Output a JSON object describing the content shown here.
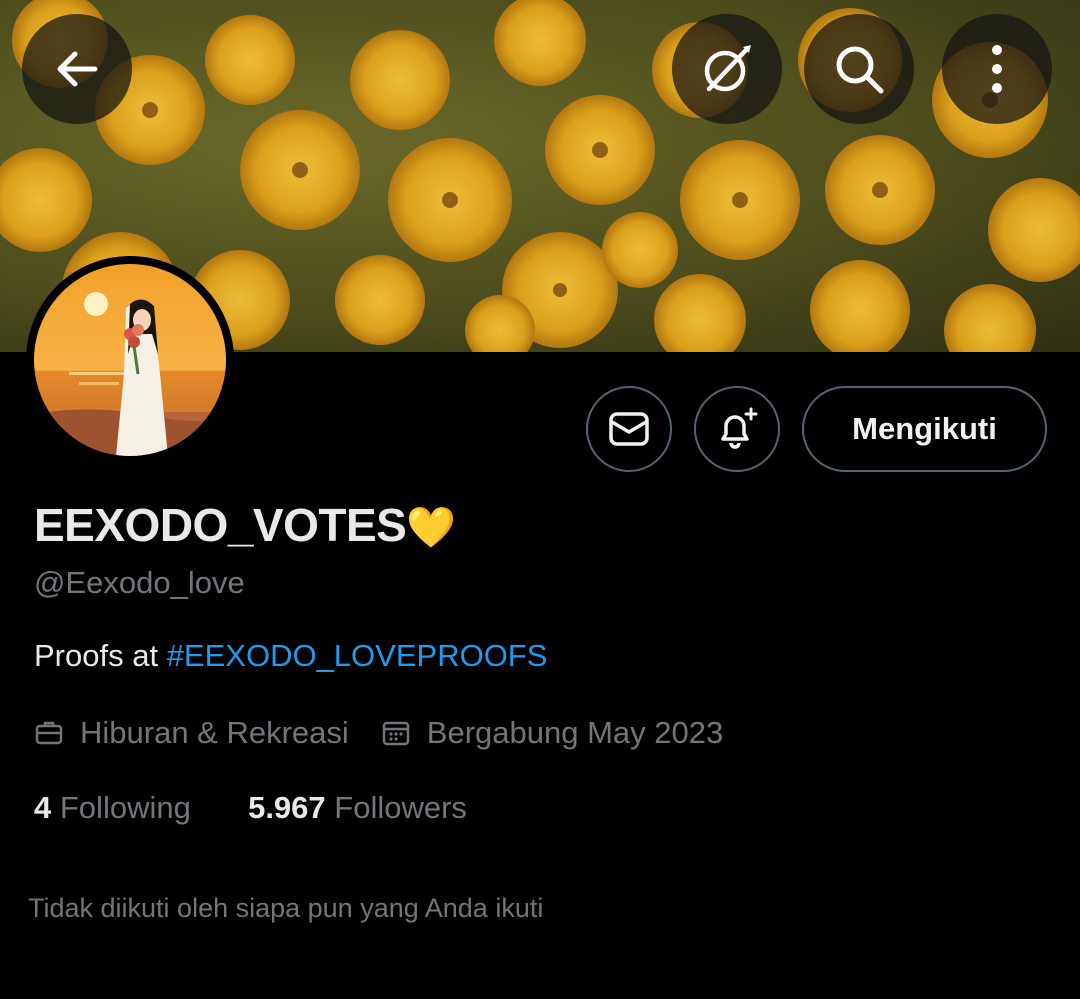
{
  "banner": {
    "description": "yellow-flowers-banner"
  },
  "header_buttons": {
    "back_icon": "arrow-left-icon",
    "grok_icon": "grok-icon",
    "search_icon": "search-icon",
    "more_icon": "more-vertical-icon"
  },
  "profile": {
    "display_name": "EEXODO_VOTES",
    "name_emoji": "💛",
    "handle": "@Eexodo_love",
    "bio_prefix": "Proofs at ",
    "bio_hashtag": "#EEXODO_LOVEPROOFS",
    "category": "Hiburan & Rekreasi",
    "joined": "Bergabung May 2023"
  },
  "actions": {
    "message_icon": "mail-icon",
    "notify_icon": "bell-plus-icon",
    "follow_label": "Mengikuti"
  },
  "stats": {
    "following_count": "4",
    "following_label": "Following",
    "followers_count": "5.967",
    "followers_label": "Followers"
  },
  "footer_note": "Tidak diikuti oleh siapa pun yang Anda ikuti",
  "colors": {
    "background": "#000000",
    "accent_link": "#1d9bf0",
    "muted_text": "#71767b",
    "button_border": "#536471"
  }
}
